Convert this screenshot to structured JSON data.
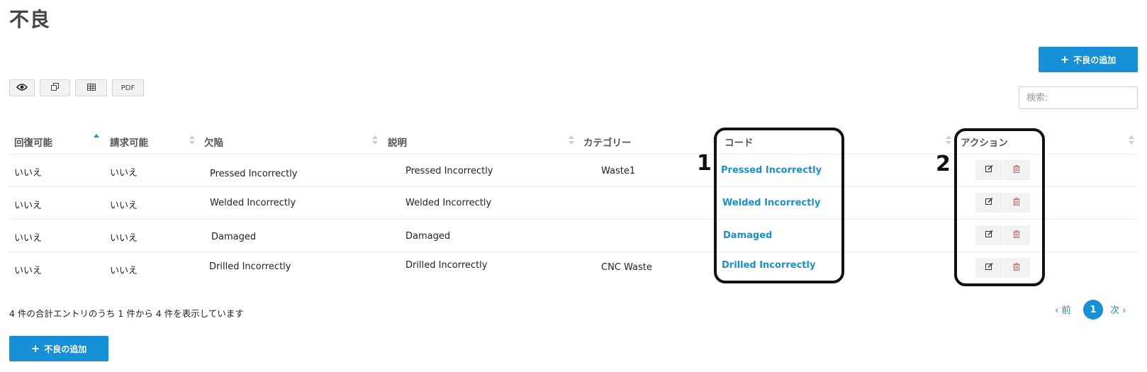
{
  "title": "不良",
  "add_button_label": "不良の追加",
  "toolbar": {
    "view_icon": "eye-icon",
    "copy_icon": "copy-icon",
    "table_icon": "table-icon",
    "pdf_label": "PDF"
  },
  "search": {
    "placeholder": "検索:"
  },
  "table": {
    "columns": [
      "回復可能",
      "請求可能",
      "欠陥",
      "説明",
      "カテゴリー",
      "コード",
      "アクション"
    ],
    "sort_column": "回復可能",
    "sort_direction": "ascending",
    "rows": [
      {
        "recoverable": "いいえ",
        "billable": "いいえ",
        "defect": "Pressed Incorrectly",
        "description": "Pressed Incorrectly",
        "category": "Waste1",
        "code": "Pressed Incorrectly"
      },
      {
        "recoverable": "いいえ",
        "billable": "いいえ",
        "defect": "Welded Incorrectly",
        "description": "Welded Incorrectly",
        "category": "",
        "code": "Welded Incorrectly"
      },
      {
        "recoverable": "いいえ",
        "billable": "いいえ",
        "defect": "Damaged",
        "description": "Damaged",
        "category": "",
        "code": "Damaged"
      },
      {
        "recoverable": "いいえ",
        "billable": "いいえ",
        "defect": "Drilled Incorrectly",
        "description": "Drilled Incorrectly",
        "category": "CNC Waste",
        "code": "Drilled Incorrectly"
      }
    ],
    "action_icons": [
      "edit-icon",
      "trash-icon"
    ]
  },
  "annotations": [
    "1",
    "2"
  ],
  "footer": {
    "info": "4 件の合計エントリのうち 1 件から 4 件を表示しています",
    "prev_label": "前",
    "next_label": "次",
    "current_page": "1"
  },
  "colors": {
    "accent": "#1690d6",
    "delete": "#e05555"
  }
}
